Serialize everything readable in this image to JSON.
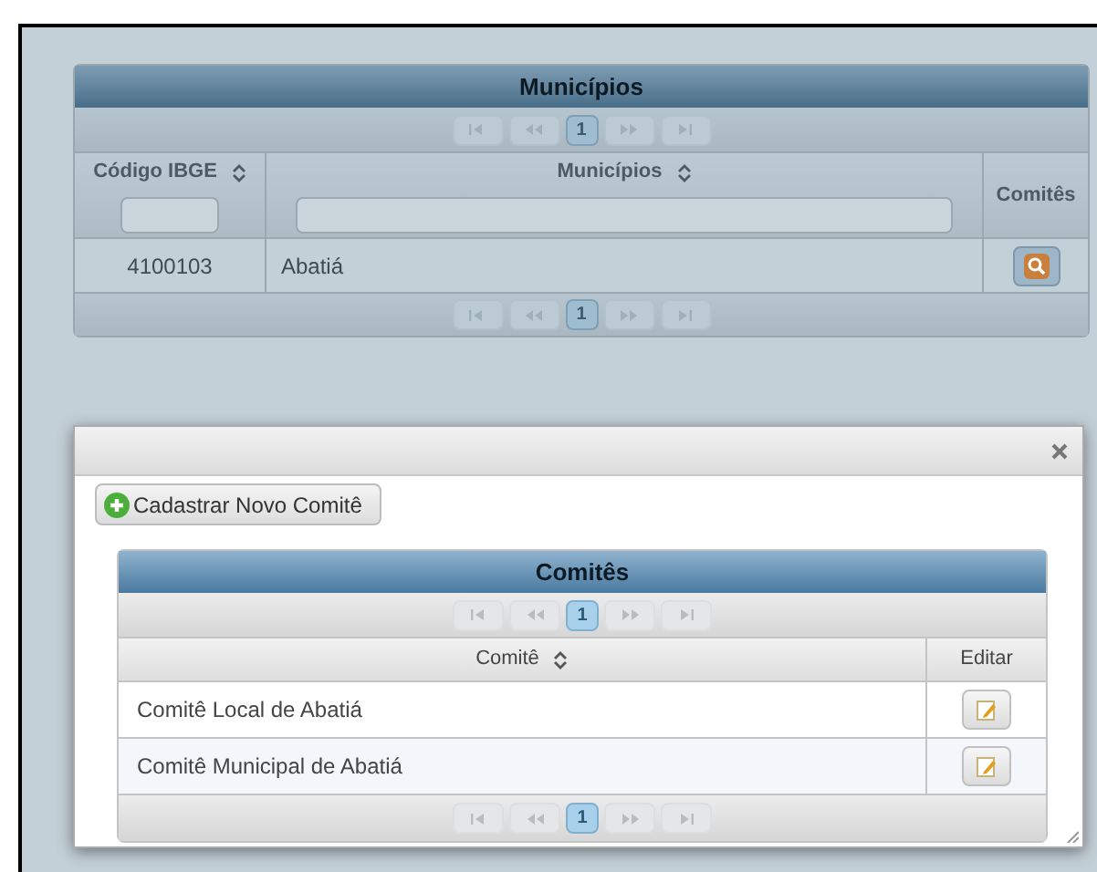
{
  "municipios": {
    "title": "Municípios",
    "pager_top": {
      "page": "1"
    },
    "columns": [
      {
        "label": "Código IBGE",
        "kind": "sort_filter"
      },
      {
        "label": "Municípios",
        "kind": "sort_filter"
      },
      {
        "label": "Comitês",
        "kind": "plain"
      }
    ],
    "rows": [
      {
        "codigo": "4100103",
        "nome": "Abatiá"
      }
    ],
    "pager_bottom": {
      "page": "1"
    }
  },
  "dialog": {
    "add_button": "Cadastrar Novo Comitê",
    "table": {
      "title": "Comitês",
      "pager_top": {
        "page": "1"
      },
      "columns": [
        {
          "label": "Comitê",
          "kind": "sort"
        },
        {
          "label": "Editar",
          "kind": "plain"
        }
      ],
      "rows": [
        {
          "name": "Comitê Local de Abatiá"
        },
        {
          "name": "Comitê Municipal de Abatiá"
        }
      ],
      "pager_bottom": {
        "page": "1"
      }
    }
  }
}
